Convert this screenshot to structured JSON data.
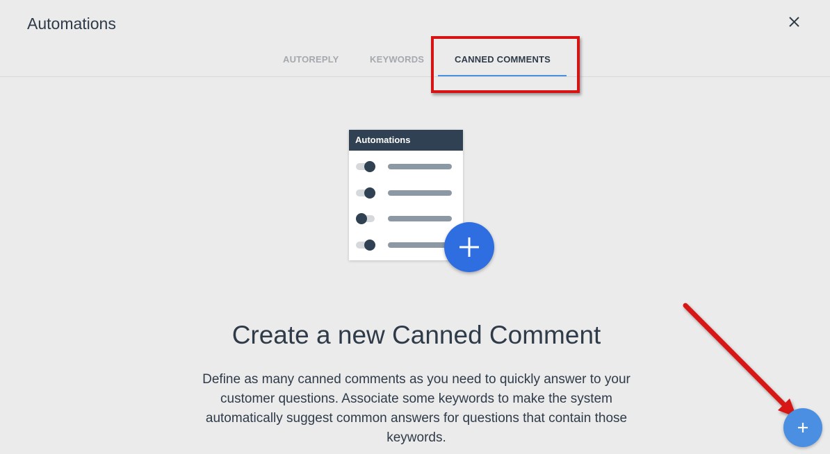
{
  "window": {
    "title": "Automations",
    "close_icon": "close-icon"
  },
  "tabs": [
    {
      "label": "AUTOREPLY",
      "active": false
    },
    {
      "label": "KEYWORDS",
      "active": false
    },
    {
      "label": "CANNED COMMENTS",
      "active": true
    }
  ],
  "illustration": {
    "card_title": "Automations",
    "rows": [
      {
        "toggle_on": true
      },
      {
        "toggle_on": true
      },
      {
        "toggle_on": false
      },
      {
        "toggle_on": true
      }
    ],
    "fab_icon": "plus-icon"
  },
  "empty_state": {
    "headline": "Create a new Canned Comment",
    "description": "Define as many canned comments as you need to quickly answer to your customer questions. Associate some keywords to make the system automatically suggest common answers for questions that contain those keywords."
  },
  "fab": {
    "icon": "plus-icon"
  },
  "colors": {
    "accent": "#4a90e2",
    "annotation": "#d71414",
    "dark": "#2f4152"
  }
}
